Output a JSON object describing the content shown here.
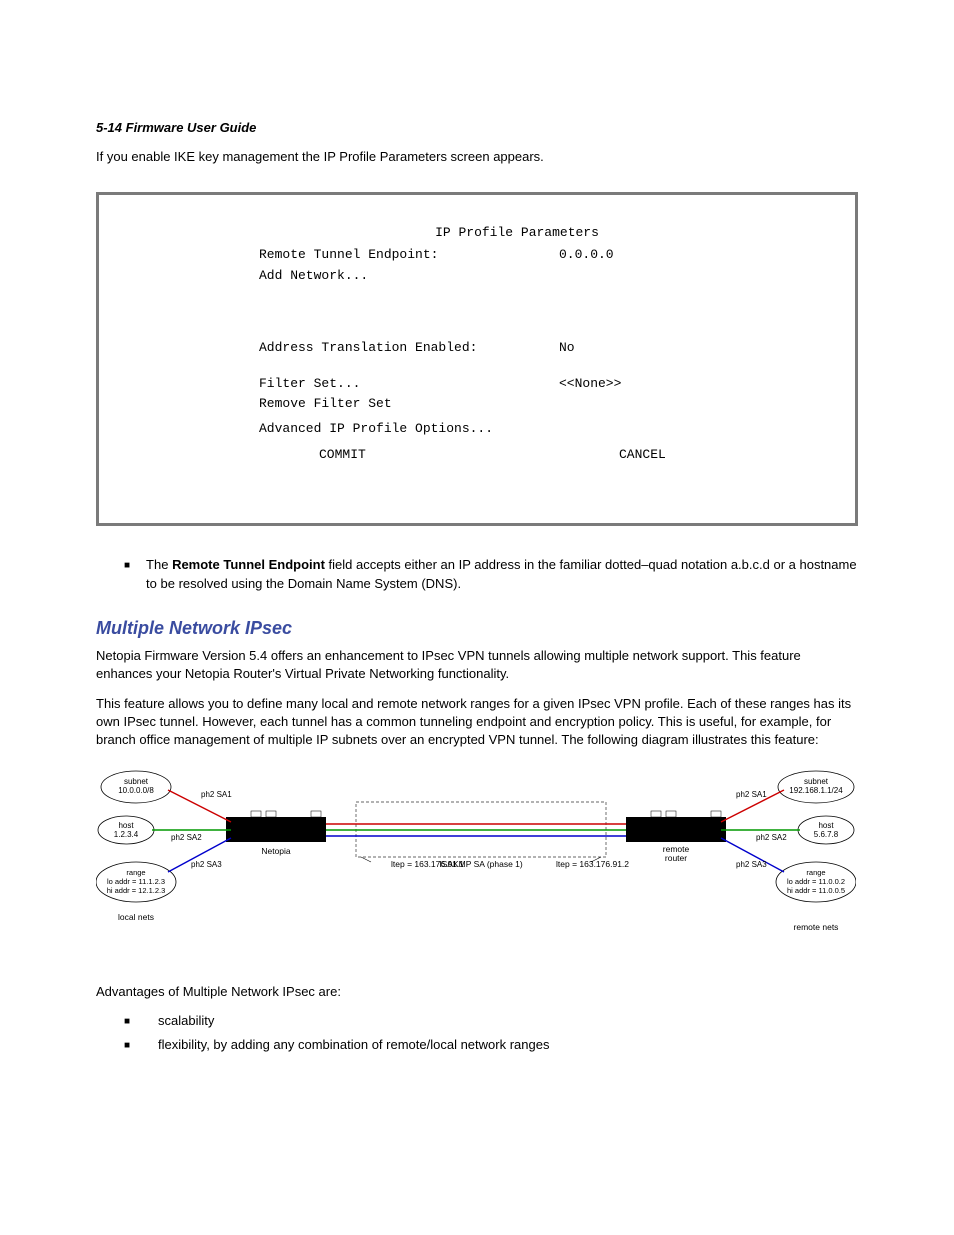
{
  "header": "5-14  Firmware User Guide",
  "intro": "If you enable IKE key management the IP Profile Parameters screen appears.",
  "ipbox": {
    "title": "IP Profile Parameters",
    "remote_tunnel_label": "Remote Tunnel Endpoint:",
    "remote_tunnel_value": "0.0.0.0",
    "add_network": "Add Network...",
    "addr_trans_label": "Address Translation Enabled:",
    "addr_trans_value": "No",
    "filter_set_label": "Filter Set...",
    "filter_set_value": "<<None>>",
    "remove_filter": "Remove Filter Set",
    "advanced": "Advanced IP Profile Options...",
    "commit": "COMMIT",
    "cancel": "CANCEL"
  },
  "bullet1_pre": "The ",
  "bullet1_bold": "Remote Tunnel Endpoint",
  "bullet1_post": " field accepts either an IP address in the familiar dotted–quad notation a.b.c.d or a hostname to be resolved using the Domain Name System (DNS).",
  "section_title": "Multiple Network IPsec",
  "para1": "Netopia Firmware Version 5.4 offers an enhancement to IPsec VPN tunnels allowing multiple network support. This feature enhances your Netopia Router's Virtual Private Networking functionality.",
  "para2": "This feature allows you to define many local and remote network ranges for a given IPsec VPN profile. Each of these ranges has its own IPsec tunnel. However, each tunnel has a common tunneling endpoint and encryption policy. This is useful, for example, for branch office management of multiple IP subnets over an encrypted VPN tunnel. The following diagram illustrates this feature:",
  "diagram": {
    "left_subnet": "subnet\n10.0.0.0/8",
    "left_host": "host\n1.2.3.4",
    "left_range": "range\nlo addr = 11.1.2.3\nhi addr = 12.1.2.3",
    "local_nets": "local nets",
    "right_subnet": "subnet\n192.168.1.1/24",
    "right_host": "host\n5.6.7.8",
    "right_range": "range\nlo addr = 11.0.0.2\nhi addr = 11.0.0.5",
    "remote_nets": "remote nets",
    "ph2sa1_l": "ph2 SA1",
    "ph2sa2_l": "ph2 SA2",
    "ph2sa3_l": "ph2 SA3",
    "ph2sa1_r": "ph2 SA1",
    "ph2sa2_r": "ph2 SA2",
    "ph2sa3_r": "ph2 SA3",
    "netopia": "Netopia",
    "remote_router": "remote\nrouter",
    "ltep_l": "ltep = 163.176.91.1",
    "ltep_r": "ltep = 163.176.91.2",
    "isakmp": "ISAKMP SA (phase 1)"
  },
  "advantages_title": "Advantages of Multiple Network IPsec are:",
  "adv1": "scalability",
  "adv2": "flexibility, by adding any combination of remote/local network ranges"
}
